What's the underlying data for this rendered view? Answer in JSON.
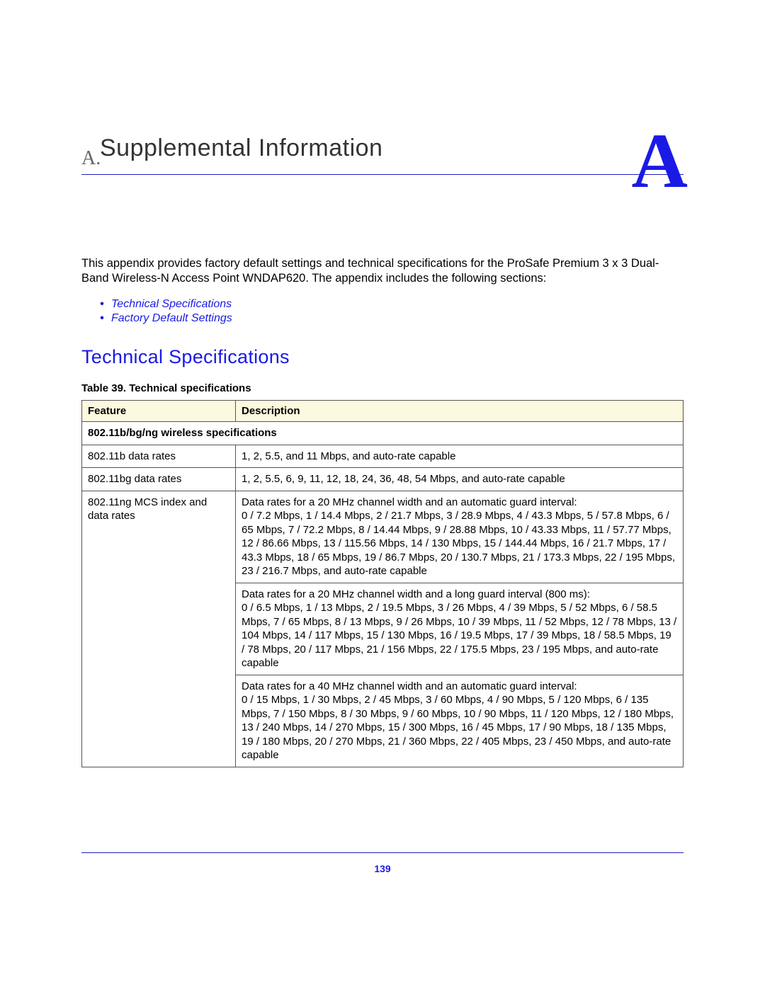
{
  "appendix_letter_small": "A.",
  "appendix_letter_big": "A",
  "title": "Supplemental Information",
  "intro": "This appendix provides factory default settings and technical specifications for the ProSafe Premium 3 x 3 Dual-Band Wireless-N Access Point WNDAP620. The appendix includes the following sections:",
  "links": {
    "0": "Technical Specifications",
    "1": "Factory Default Settings"
  },
  "section_heading": "Technical Specifications",
  "table_caption": "Table 39.  Technical specifications",
  "columns": {
    "feature": "Feature",
    "description": "Description"
  },
  "subhead": "802.11b/bg/ng wireless specifications",
  "rows": {
    "r1": {
      "feature": "802.11b data rates",
      "desc": "1, 2, 5.5, and 11 Mbps, and auto-rate capable"
    },
    "r2": {
      "feature": "802.11bg data rates",
      "desc": "1, 2, 5.5, 6, 9, 11, 12, 18, 24, 36, 48, 54 Mbps, and auto-rate capable"
    },
    "r3": {
      "feature": "802.11ng MCS index and data rates",
      "d20auto_h": "Data rates for a 20 MHz channel width and an automatic guard interval:",
      "d20auto_b": "0 / 7.2 Mbps, 1 / 14.4 Mbps, 2 / 21.7 Mbps, 3 / 28.9 Mbps, 4 / 43.3 Mbps, 5 / 57.8 Mbps, 6 / 65 Mbps, 7 / 72.2 Mbps, 8 / 14.44 Mbps, 9 / 28.88 Mbps, 10 / 43.33 Mbps, 11 / 57.77 Mbps, 12 / 86.66 Mbps, 13 / 115.56 Mbps, 14 / 130 Mbps, 15 / 144.44 Mbps, 16 / 21.7 Mbps, 17 / 43.3 Mbps, 18 / 65 Mbps, 19 / 86.7 Mbps, 20 / 130.7 Mbps, 21 / 173.3 Mbps, 22 / 195 Mbps, 23 / 216.7 Mbps, and auto-rate capable",
      "d20long_h": "Data rates for a 20 MHz channel width and a long guard interval (800 ms):",
      "d20long_b": "0 / 6.5 Mbps, 1 / 13 Mbps, 2 / 19.5 Mbps, 3 / 26 Mbps, 4 / 39 Mbps, 5 / 52 Mbps, 6 / 58.5 Mbps, 7 / 65 Mbps, 8 / 13 Mbps, 9 / 26 Mbps, 10 / 39 Mbps, 11 / 52 Mbps, 12 / 78 Mbps, 13 / 104 Mbps, 14 / 117 Mbps, 15 / 130 Mbps, 16 / 19.5 Mbps, 17 / 39 Mbps, 18 / 58.5 Mbps, 19 / 78 Mbps, 20 / 117 Mbps, 21 / 156 Mbps, 22 / 175.5 Mbps, 23 / 195 Mbps, and auto-rate capable",
      "d40auto_h": "Data rates for a 40 MHz channel width and an automatic guard interval:",
      "d40auto_b": "0 / 15 Mbps, 1 / 30 Mbps, 2 / 45 Mbps, 3 / 60 Mbps, 4 / 90 Mbps, 5 / 120 Mbps, 6 / 135 Mbps, 7 / 150 Mbps, 8 / 30 Mbps, 9 / 60 Mbps, 10 / 90 Mbps, 11 / 120 Mbps, 12 / 180 Mbps, 13 / 240 Mbps, 14 / 270 Mbps, 15 / 300 Mbps, 16 / 45 Mbps, 17 / 90 Mbps, 18 / 135 Mbps, 19 / 180 Mbps, 20 / 270 Mbps, 21 / 360 Mbps, 22 / 405 Mbps, 23 / 450 Mbps, and auto-rate capable"
    }
  },
  "page_number": "139"
}
